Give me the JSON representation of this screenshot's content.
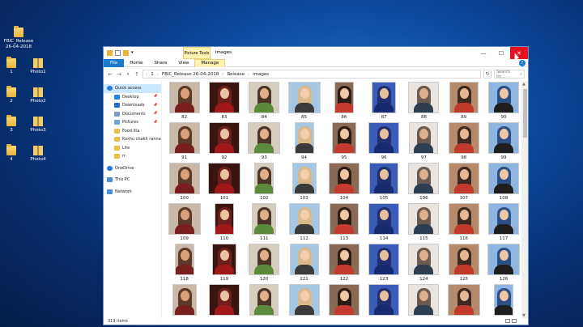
{
  "desktop": {
    "items": [
      {
        "label": "FBIC_Release 26-04-2018",
        "icon": "folder-icon"
      },
      {
        "label": "1",
        "icon": "folder-icon"
      },
      {
        "label": "Photo1",
        "icon": "zip-folder-icon"
      },
      {
        "label": "2",
        "icon": "folder-icon"
      },
      {
        "label": "Photo2",
        "icon": "zip-folder-icon"
      },
      {
        "label": "3",
        "icon": "folder-icon"
      },
      {
        "label": "Photo3",
        "icon": "zip-folder-icon"
      },
      {
        "label": "4",
        "icon": "folder-icon"
      },
      {
        "label": "Photo4",
        "icon": "zip-folder-icon"
      }
    ]
  },
  "window": {
    "title": "images",
    "contextual_tab_group": "Picture Tools",
    "controls": {
      "minimize": "—",
      "maximize": "☐",
      "close": "✕"
    },
    "ribbon_tabs": [
      {
        "label": "File"
      },
      {
        "label": "Home"
      },
      {
        "label": "Share"
      },
      {
        "label": "View"
      },
      {
        "label": "Manage"
      }
    ],
    "help": "?",
    "address": {
      "path": [
        "1",
        "FBIC_Release 26-04-2018",
        "Release",
        "images"
      ],
      "search_placeholder": "Search im..."
    },
    "sidebar": [
      {
        "label": "Quick access",
        "icon": "star-icon",
        "color": "#2b79d6"
      },
      {
        "label": "Desktop",
        "icon": "desktop-icon",
        "color": "#1f87e0",
        "pinned": true
      },
      {
        "label": "Downloads",
        "icon": "download-icon",
        "color": "#1f6fd0",
        "pinned": true
      },
      {
        "label": "Documents",
        "icon": "documents-icon",
        "color": "#7b9cc7",
        "pinned": true
      },
      {
        "label": "Pictures",
        "icon": "pictures-icon",
        "color": "#6aa7d8",
        "pinned": true
      },
      {
        "label": "Food lita",
        "icon": "folder-icon",
        "color": "#e9c04a"
      },
      {
        "label": "Koshu chakh ranna",
        "icon": "folder-icon",
        "color": "#e9c04a"
      },
      {
        "label": "Lite",
        "icon": "folder-icon",
        "color": "#e9c04a"
      },
      {
        "label": "rr",
        "icon": "folder-icon",
        "color": "#e9c04a"
      },
      {
        "label": "OneDrive",
        "icon": "cloud-icon",
        "color": "#2a7ad6"
      },
      {
        "label": "This PC",
        "icon": "computer-icon",
        "color": "#4a90d9"
      },
      {
        "label": "Network",
        "icon": "network-icon",
        "color": "#4a90d9"
      }
    ],
    "pin_glyph": "📌",
    "thumbnails": [
      {
        "label": "82"
      },
      {
        "label": "83"
      },
      {
        "label": "84"
      },
      {
        "label": "85"
      },
      {
        "label": "86"
      },
      {
        "label": "87"
      },
      {
        "label": "88"
      },
      {
        "label": "89"
      },
      {
        "label": "90"
      },
      {
        "label": "91"
      },
      {
        "label": "92"
      },
      {
        "label": "93"
      },
      {
        "label": "94"
      },
      {
        "label": "95"
      },
      {
        "label": "96"
      },
      {
        "label": "97"
      },
      {
        "label": "98"
      },
      {
        "label": "99"
      },
      {
        "label": "100"
      },
      {
        "label": "101"
      },
      {
        "label": "102"
      },
      {
        "label": "103"
      },
      {
        "label": "104"
      },
      {
        "label": "105"
      },
      {
        "label": "106"
      },
      {
        "label": "107"
      },
      {
        "label": "108"
      },
      {
        "label": "109"
      },
      {
        "label": "110"
      },
      {
        "label": "111"
      },
      {
        "label": "112"
      },
      {
        "label": "113"
      },
      {
        "label": "114"
      },
      {
        "label": "115"
      },
      {
        "label": "116"
      },
      {
        "label": "117"
      },
      {
        "label": "118"
      },
      {
        "label": "119"
      },
      {
        "label": "120"
      },
      {
        "label": "121"
      },
      {
        "label": "122"
      },
      {
        "label": "123"
      },
      {
        "label": "124"
      },
      {
        "label": "125"
      },
      {
        "label": "126"
      },
      {
        "label": ""
      },
      {
        "label": ""
      },
      {
        "label": ""
      },
      {
        "label": ""
      },
      {
        "label": ""
      },
      {
        "label": ""
      },
      {
        "label": ""
      },
      {
        "label": ""
      },
      {
        "label": ""
      }
    ],
    "status": "319 items"
  }
}
